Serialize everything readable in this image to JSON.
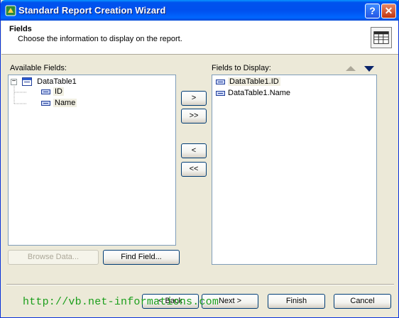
{
  "window": {
    "title": "Standard Report Creation Wizard"
  },
  "titlebar": {
    "help_label": "?",
    "close_label": "✕"
  },
  "header": {
    "title": "Fields",
    "subtitle": "Choose the information to display on the report."
  },
  "available": {
    "label": "Available Fields:",
    "table_name": "DataTable1",
    "expander": "−",
    "fields": [
      "ID",
      "Name"
    ]
  },
  "display": {
    "label": "Fields to Display:",
    "fields": [
      "DataTable1.ID",
      "DataTable1.Name"
    ]
  },
  "move_buttons": {
    "add": ">",
    "add_all": ">>",
    "remove": "<",
    "remove_all": "<<"
  },
  "bottom_buttons": {
    "browse_data": "Browse Data...",
    "find_field": "Find Field...",
    "back": "< Back",
    "next": "Next >",
    "finish": "Finish",
    "cancel": "Cancel"
  },
  "watermark": "http://vb.net-informations.com",
  "colors": {
    "titlebar": "#0053ee",
    "dialog_bg": "#ece9d8",
    "watermark": "#1a9e1a"
  }
}
